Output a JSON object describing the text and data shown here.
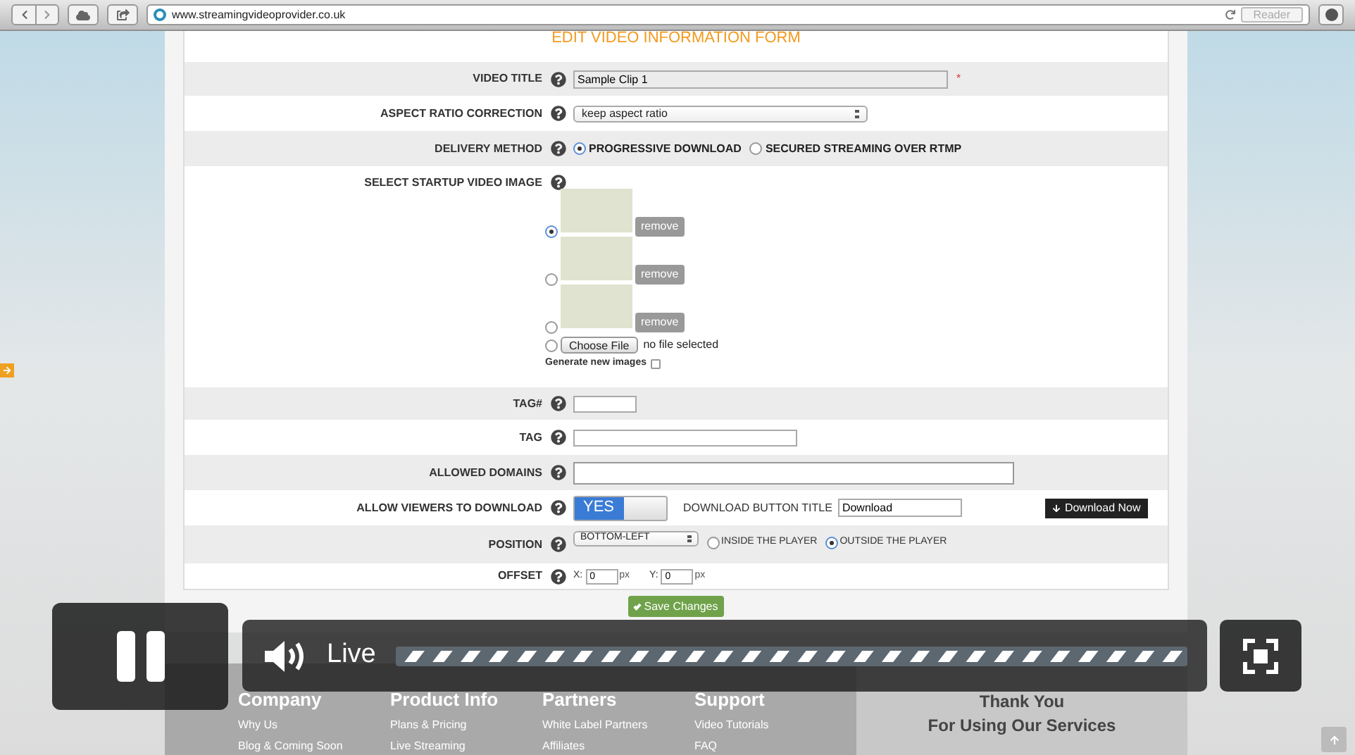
{
  "browser": {
    "url": "www.streamingvideoprovider.co.uk",
    "reader": "Reader"
  },
  "form": {
    "title": "EDIT VIDEO INFORMATION FORM",
    "video_title": {
      "label": "VIDEO TITLE",
      "value": "Sample Clip 1",
      "required_mark": "*"
    },
    "aspect_ratio": {
      "label": "ASPECT RATIO CORRECTION",
      "value": "keep aspect ratio"
    },
    "delivery_method": {
      "label": "DELIVERY METHOD",
      "options": [
        {
          "label": "PROGRESSIVE DOWNLOAD",
          "selected": true
        },
        {
          "label": "SECURED STREAMING OVER RTMP",
          "selected": false
        }
      ]
    },
    "startup_image": {
      "label": "SELECT STARTUP VIDEO IMAGE",
      "images": [
        {
          "selected": true,
          "remove": "remove"
        },
        {
          "selected": false,
          "remove": "remove"
        },
        {
          "selected": false,
          "remove": "remove"
        }
      ],
      "upload": {
        "selected": false,
        "button": "Choose File",
        "status": "no file selected"
      },
      "generate": {
        "label": "Generate new images",
        "checked": false
      }
    },
    "tag_number": {
      "label": "TAG#"
    },
    "tag": {
      "label": "TAG"
    },
    "allowed_domains": {
      "label": "ALLOWED DOMAINS"
    },
    "allow_download": {
      "label": "ALLOW VIEWERS TO DOWNLOAD",
      "toggle": {
        "text": "YES",
        "on": true
      },
      "button_title_label": "DOWNLOAD BUTTON TITLE",
      "button_title_value": "Download",
      "preview_button": "Download Now"
    },
    "position": {
      "label": "POSITION",
      "value": "BOTTOM-LEFT",
      "options": [
        {
          "label": "INSIDE THE PLAYER",
          "selected": false
        },
        {
          "label": "OUTSIDE THE PLAYER",
          "selected": true
        }
      ]
    },
    "offset": {
      "label": "OFFSET",
      "x_label": "X:",
      "x_value": "0",
      "x_unit": "px",
      "y_label": "Y:",
      "y_value": "0",
      "y_unit": "px"
    },
    "save": "Save Changes"
  },
  "footer": {
    "columns": [
      {
        "heading": "Company",
        "links": [
          "Why Us",
          "Blog & Coming Soon"
        ]
      },
      {
        "heading": "Product Info",
        "links": [
          "Plans & Pricing",
          "Live Streaming"
        ]
      },
      {
        "heading": "Partners",
        "links": [
          "White Label Partners",
          "Affiliates"
        ]
      },
      {
        "heading": "Support",
        "links": [
          "Video Tutorials",
          "FAQ"
        ]
      }
    ],
    "thanks": [
      "Thank You",
      "For Using Our Services"
    ]
  },
  "player": {
    "playing": true,
    "muted": false,
    "live_label": "Live"
  }
}
